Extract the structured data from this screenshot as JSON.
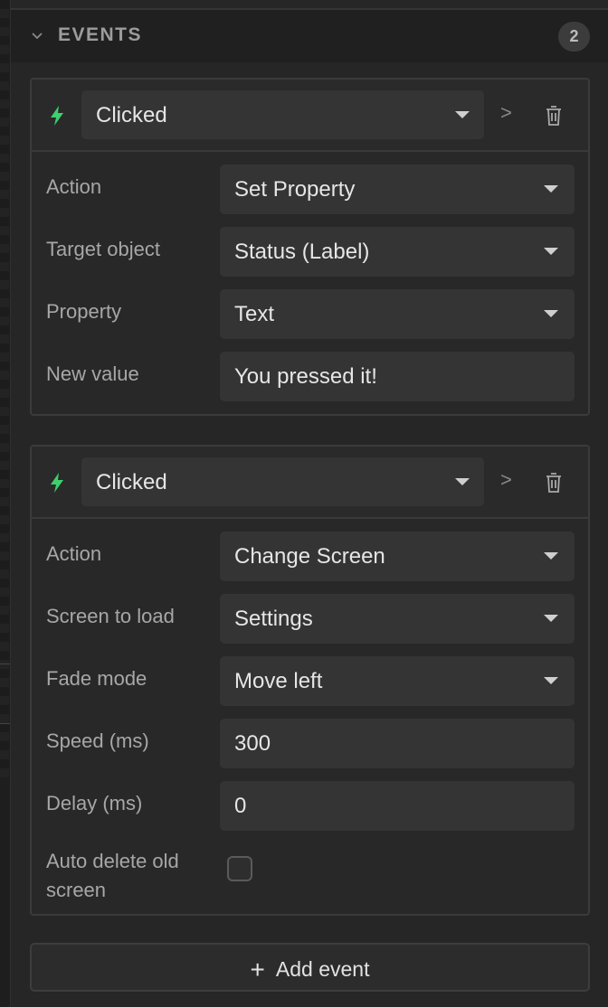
{
  "section": {
    "title": "EVENTS",
    "count": "2"
  },
  "events": [
    {
      "trigger": "Clicked",
      "arrow": ">",
      "rows": [
        {
          "label": "Action",
          "value": "Set Property",
          "kind": "select"
        },
        {
          "label": "Target object",
          "value": "Status (Label)",
          "kind": "select"
        },
        {
          "label": "Property",
          "value": "Text",
          "kind": "select"
        },
        {
          "label": "New value",
          "value": "You pressed it!",
          "kind": "input"
        }
      ]
    },
    {
      "trigger": "Clicked",
      "arrow": ">",
      "rows": [
        {
          "label": "Action",
          "value": "Change Screen",
          "kind": "select"
        },
        {
          "label": "Screen to load",
          "value": "Settings",
          "kind": "select"
        },
        {
          "label": "Fade mode",
          "value": "Move left",
          "kind": "select"
        },
        {
          "label": "Speed (ms)",
          "value": "300",
          "kind": "input"
        },
        {
          "label": "Delay (ms)",
          "value": "0",
          "kind": "input"
        },
        {
          "label_line1": "Auto delete old",
          "label_line2": "screen",
          "checked": false,
          "kind": "checkbox"
        }
      ]
    }
  ],
  "add_button": {
    "label": "Add event",
    "icon": "plus-icon"
  },
  "colors": {
    "bolt": "#3ecf6e",
    "background": "#262626",
    "field": "#343434"
  }
}
